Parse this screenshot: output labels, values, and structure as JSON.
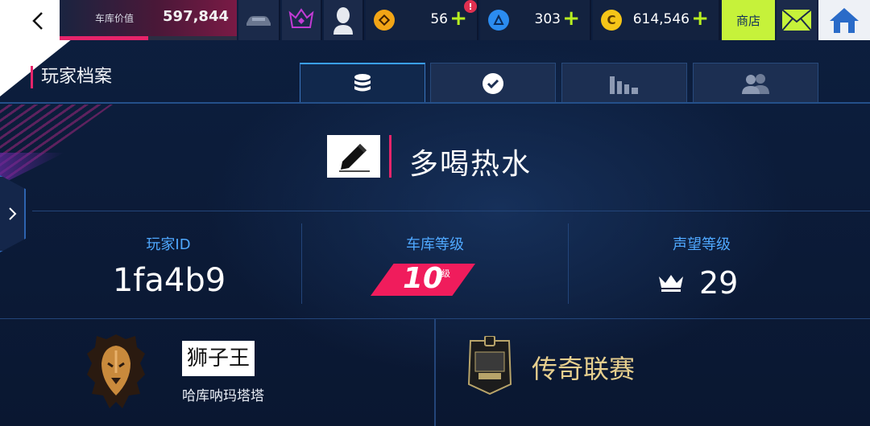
{
  "topbar": {
    "back_icon": "chevron-left-icon",
    "garage_value": {
      "label": "车库价值",
      "value": "597,844",
      "progress": 0.5
    },
    "icons": [
      "car-icon",
      "crown-emblem-icon",
      "avatar-icon"
    ],
    "currencies": [
      {
        "icon": "orange-token-icon",
        "amount": "56",
        "color": "#f2a516",
        "alert": "!"
      },
      {
        "icon": "blue-token-icon",
        "amount": "303",
        "color": "#2b8cf0"
      },
      {
        "icon": "gold-coin-icon",
        "amount": "614,546",
        "color": "#f5c518"
      }
    ],
    "plus": "+",
    "shop_label": "商店",
    "mail_icon": "mail-icon",
    "home_icon": "home-icon"
  },
  "header": {
    "title": "玩家档案",
    "tabs": [
      {
        "icon": "database-icon",
        "active": true
      },
      {
        "icon": "check-circle-icon",
        "active": false
      },
      {
        "icon": "bar-chart-icon",
        "active": false
      },
      {
        "icon": "friends-icon",
        "active": false
      }
    ]
  },
  "profile": {
    "name": "多喝热水",
    "edit_icon": "pencil-icon",
    "stats": {
      "player_id_label": "玩家ID",
      "player_id": "1fa4b9",
      "garage_level_label": "车库等级",
      "garage_level": "10",
      "garage_level_unit": "级",
      "prestige_label": "声望等级",
      "prestige": "29",
      "prestige_icon": "crown-icon"
    }
  },
  "club": {
    "emblem": "lion-emblem-icon",
    "name": "狮子王",
    "subtitle": "哈库呐玛塔塔"
  },
  "league": {
    "badge": "legend-league-badge-icon",
    "name": "传奇联赛"
  },
  "colors": {
    "accent_pink": "#e6246a",
    "lime": "#c6f23a",
    "blue_label": "#4fa8ff",
    "gold": "#e7cf8e"
  }
}
